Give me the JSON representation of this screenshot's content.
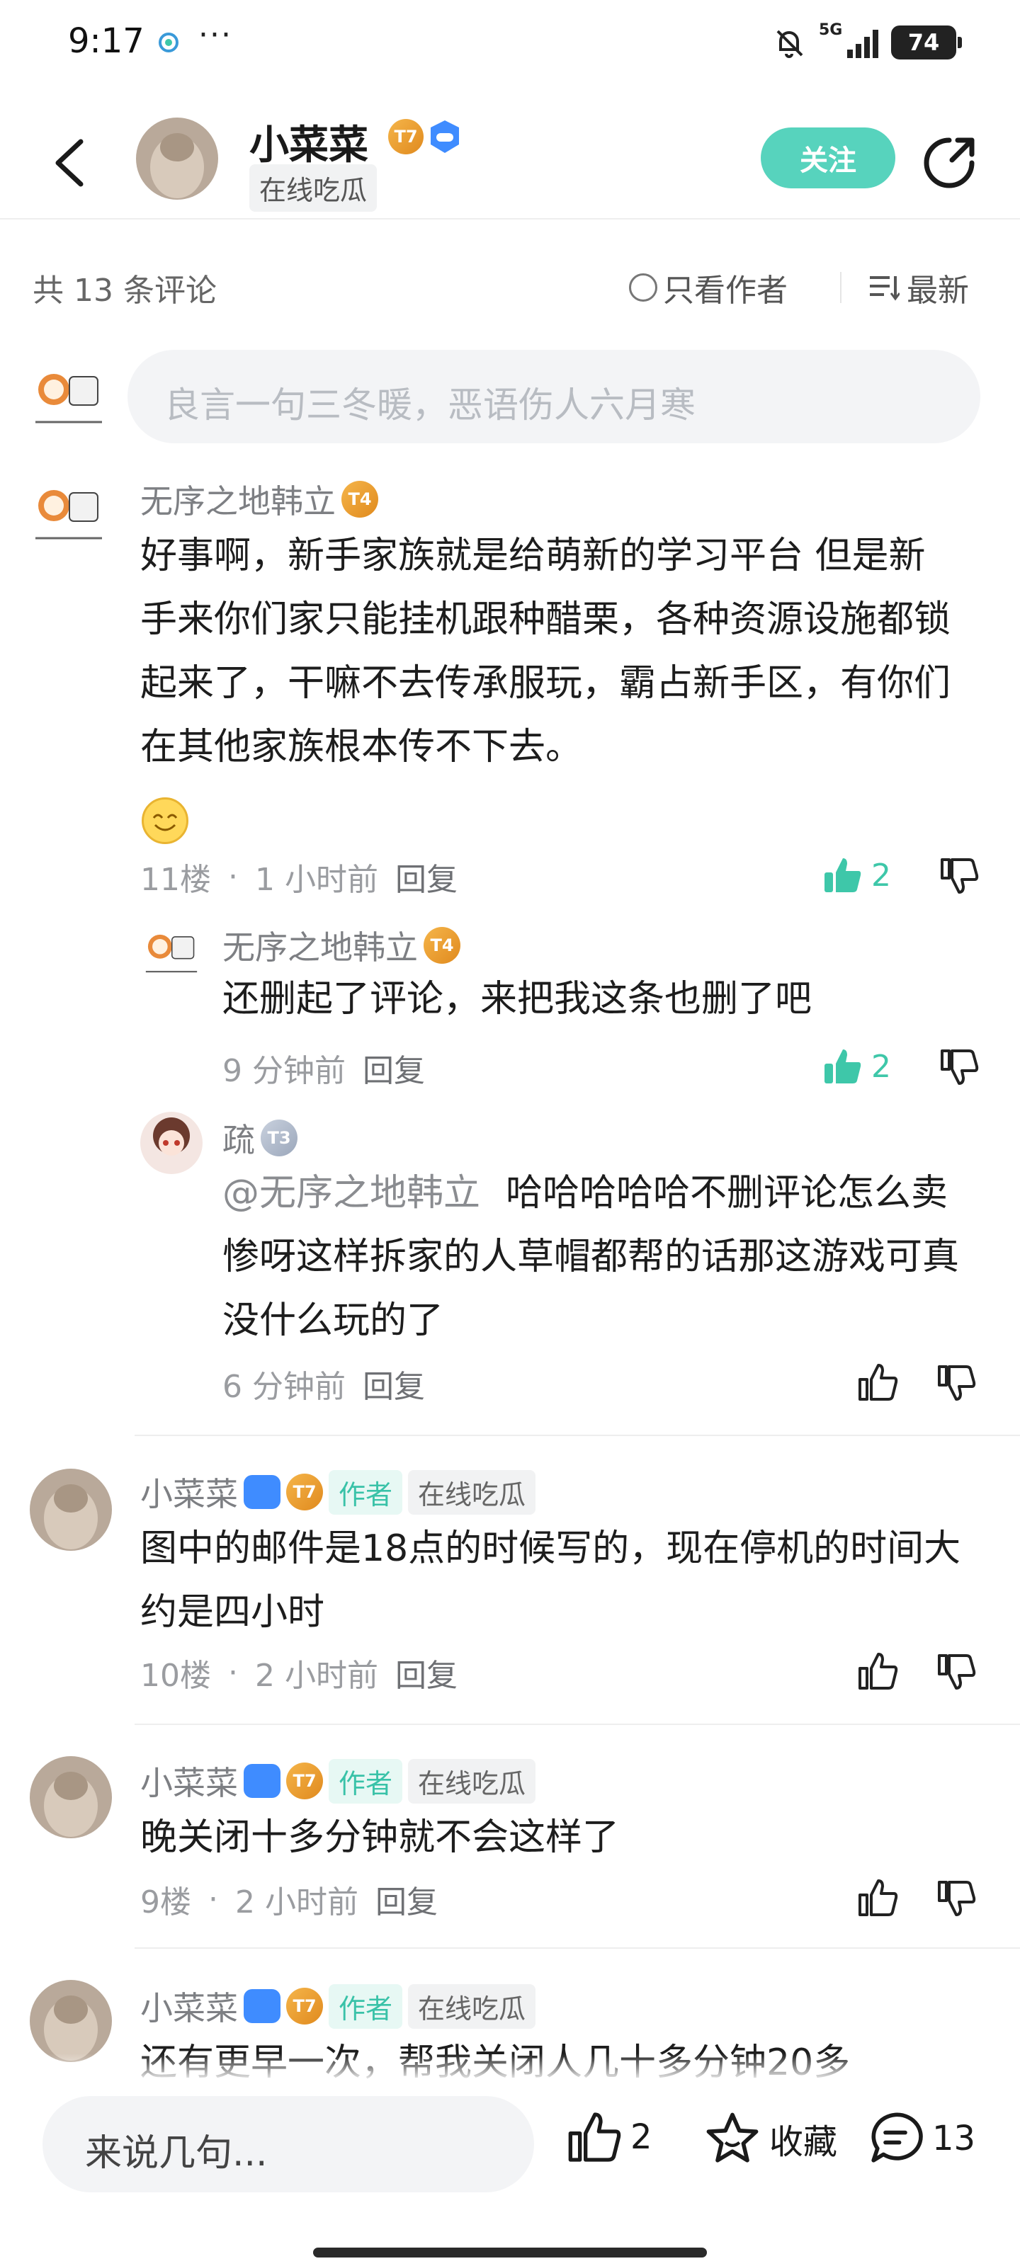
{
  "status_bar": {
    "time": "9:17",
    "more": "···",
    "network": "5G",
    "battery": "74"
  },
  "header": {
    "name": "小菜菜",
    "status": "在线吃瓜",
    "follow_label": "关注",
    "badges": [
      "T7-badge-icon",
      "gamepad-badge-icon"
    ]
  },
  "comment_bar": {
    "count_text": "共 13 条评论",
    "only_author_label": "只看作者",
    "sort_label": "最新"
  },
  "input": {
    "placeholder": "良言一句三冬暖，恶语伤人六月寒"
  },
  "comments": [
    {
      "name": "无序之地韩立",
      "level": "4",
      "text": "好事啊，新手家族就是给萌新的学习平台 但是新手来你们家只能挂机跟种醋栗，各种资源设施都锁起来了，干嘛不去传承服玩，霸占新手区，有你们在其他家族根本传不下去。",
      "emoji": "smile-emoji",
      "floor": "11楼",
      "time": "1 小时前",
      "reply": "回复",
      "likes": "2",
      "replies": [
        {
          "name": "无序之地韩立",
          "level": "4",
          "text": "还删起了评论，来把我这条也删了吧",
          "time": "9 分钟前",
          "reply": "回复",
          "likes": "2"
        },
        {
          "name": "疏",
          "level": "3",
          "mention": "@无序之地韩立",
          "text": "哈哈哈哈哈不删评论怎么卖惨呀这样拆家的人草帽都帮的话那这游戏可真没什么玩的了",
          "time": "6 分钟前",
          "reply": "回复"
        }
      ]
    },
    {
      "name": "小菜菜",
      "level": "7",
      "author_tag": "作者",
      "status": "在线吃瓜",
      "text": "图中的邮件是18点的时候写的，现在停机的时间大约是四小时",
      "floor": "10楼",
      "time": "2 小时前",
      "reply": "回复"
    },
    {
      "name": "小菜菜",
      "level": "7",
      "author_tag": "作者",
      "status": "在线吃瓜",
      "text": "晚关闭十多分钟就不会这样了",
      "floor": "9楼",
      "time": "2 小时前",
      "reply": "回复"
    },
    {
      "name": "小菜菜",
      "level": "7",
      "author_tag": "作者",
      "status": "在线吃瓜",
      "text": "还有更早一次，帮我关闭人几十多分钟20多"
    }
  ],
  "bottom_bar": {
    "placeholder": "来说几句...",
    "like_count": "2",
    "favorite_label": "收藏",
    "comment_count": "13"
  },
  "colors": {
    "accent": "#57d3bd",
    "like": "#3ec7a9",
    "author_tag": "#39c2a8"
  }
}
